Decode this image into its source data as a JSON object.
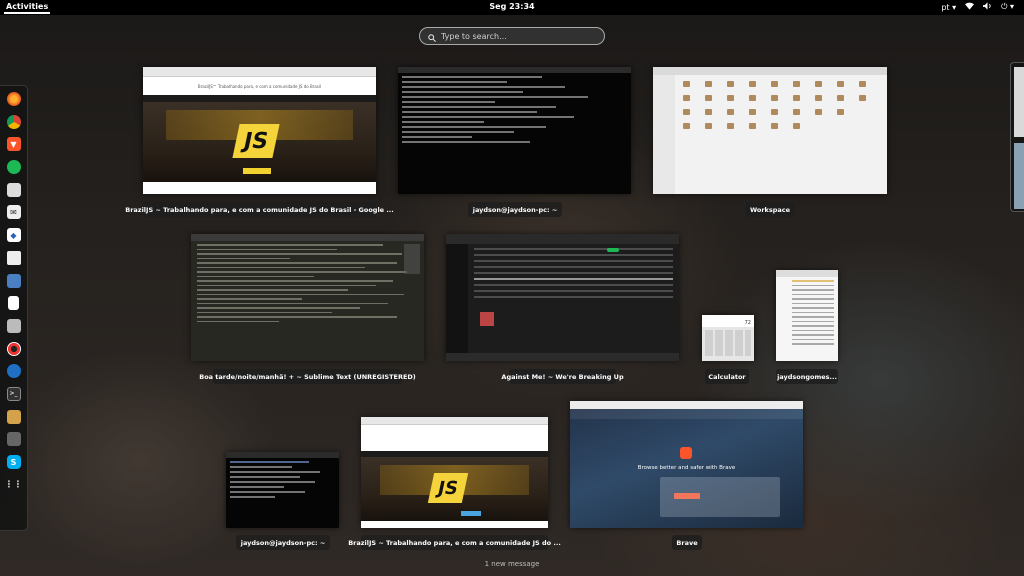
{
  "topbar": {
    "activities": "Activities",
    "clock": "Seg 23:34",
    "language": "pt ▾",
    "network_icon": "wifi-icon",
    "volume_icon": "volume-icon",
    "power": "⏻ ▾"
  },
  "search": {
    "placeholder": "Type to search..."
  },
  "dock": {
    "items": [
      "firefox",
      "chrome",
      "brave",
      "spotify",
      "screenshot",
      "mail",
      "package",
      "disk",
      "desktop",
      "document",
      "drive",
      "lifesaver",
      "files",
      "terminal",
      "photos",
      "calculator",
      "skype",
      "app-grid"
    ]
  },
  "windows": {
    "w1": {
      "caption": "BrazilJS ~ Trabalhando para, e com a comunidade JS do Brasil - Google ...",
      "site_title": "BrazilJS™ Trabalhando para, e com a comunidade JS do Brasil",
      "logo": "JS"
    },
    "w2": {
      "caption": "jaydson@jaydson-pc: ~"
    },
    "w3": {
      "caption": "Workspace"
    },
    "w4": {
      "caption": "Boa tarde/noite/manhã! + ~ Sublime Text (UNREGISTERED)"
    },
    "w5": {
      "caption": "Against Me! ~ We're Breaking Up"
    },
    "w6": {
      "caption": "Calculator",
      "display": "72"
    },
    "w7": {
      "caption": "jaydsongomes..."
    },
    "w8": {
      "caption": "jaydson@jaydson-pc: ~"
    },
    "w9": {
      "caption": "BrazilJS ~ Trabalhando para, e com a comunidade JS do ...",
      "logo": "JS"
    },
    "w10": {
      "caption": "Brave",
      "headline": "Browse better and safer with Brave"
    }
  },
  "notification": "1 new message"
}
